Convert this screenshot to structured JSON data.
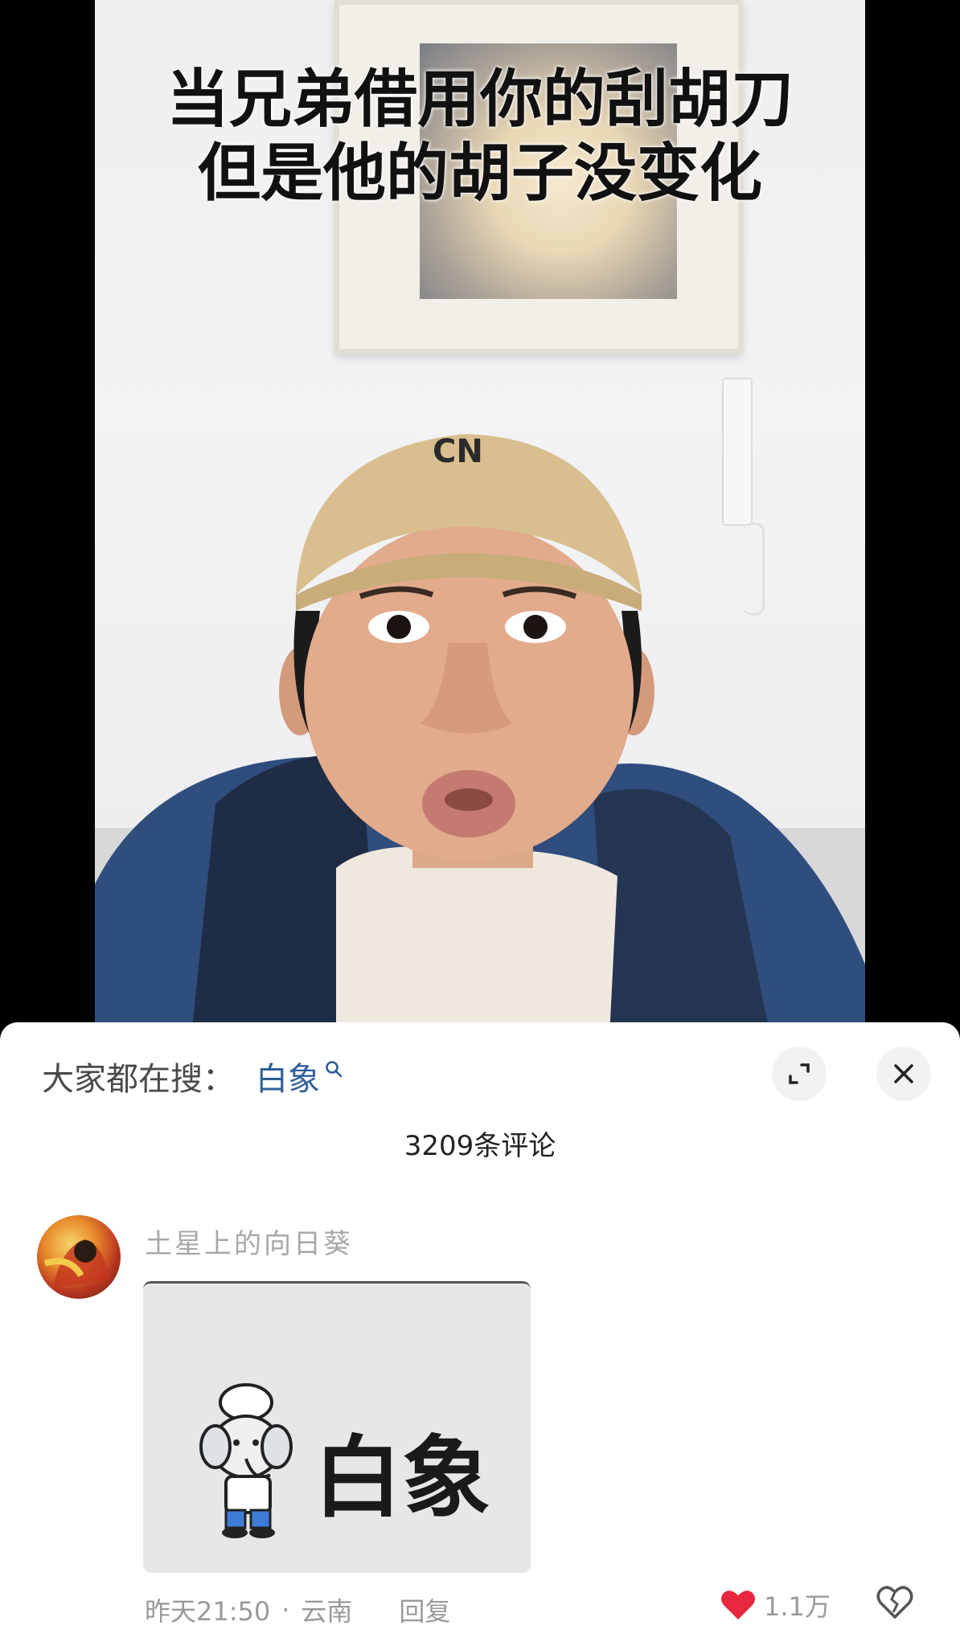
{
  "video": {
    "caption_line1": "当兄弟借用你的刮胡刀",
    "caption_line2": "但是他的胡子没变化",
    "cap_text": "CN"
  },
  "comments_panel": {
    "search_prefix": "大家都在搜：",
    "search_term": "白象",
    "comment_count_label": "3209条评论"
  },
  "comment": {
    "username": "土星上的向日葵",
    "sticker_text": "白象",
    "time": "昨天21:50",
    "separator": "·",
    "location": "云南",
    "reply_label": "回复",
    "like_count": "1.1万"
  },
  "colors": {
    "like_red": "#e8273e",
    "search_term_blue": "#2f5f9a"
  }
}
